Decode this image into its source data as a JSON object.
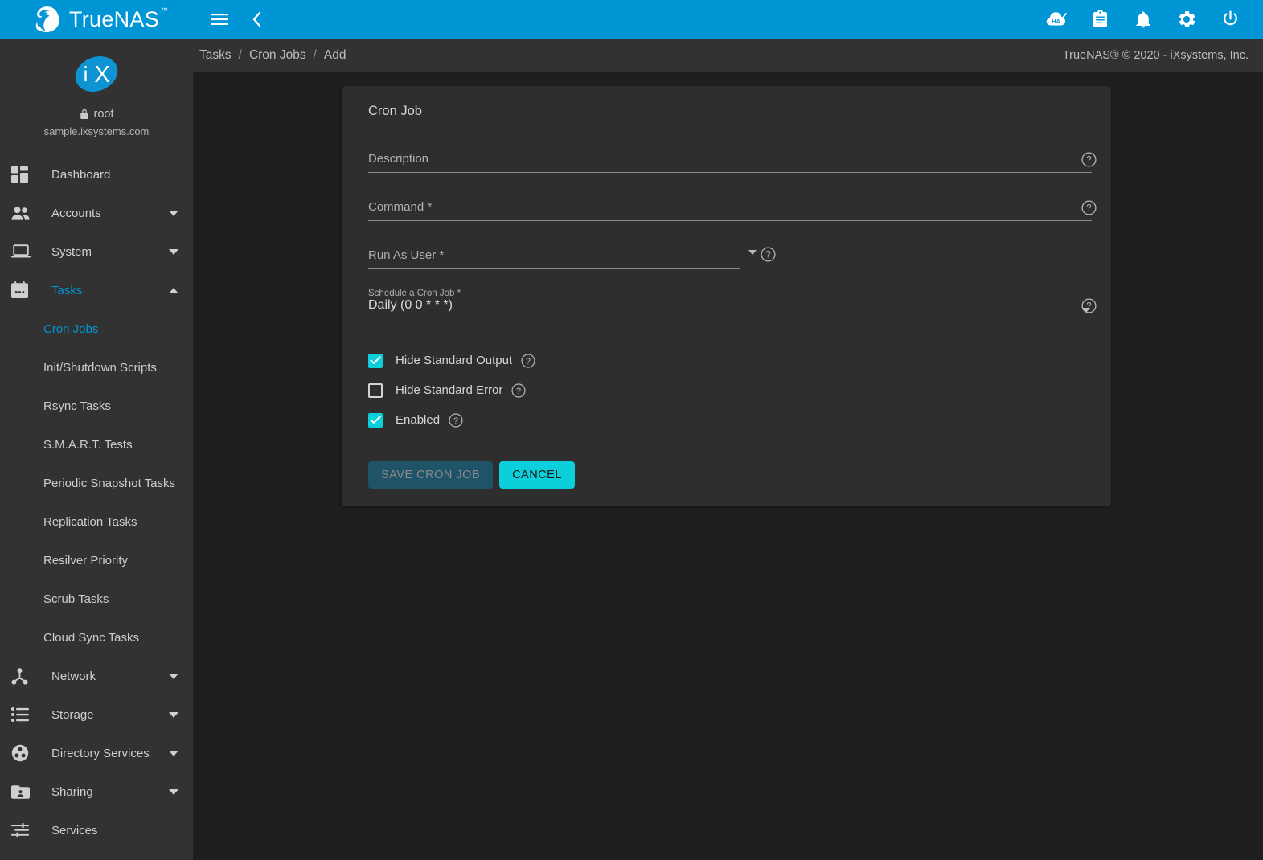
{
  "brand": {
    "name": "TrueNAS",
    "trademark": "™",
    "logo_icon": "truenas-logo-icon"
  },
  "topbar": {
    "menu_toggle_icon": "hamburger-menu-icon",
    "collapse_icon": "chevron-left-icon",
    "right_icons": [
      {
        "name": "ha-status-icon",
        "title": "HA"
      },
      {
        "name": "task-manager-icon",
        "title": ""
      },
      {
        "name": "notifications-bell-icon",
        "title": ""
      },
      {
        "name": "settings-gear-icon",
        "title": ""
      },
      {
        "name": "power-icon",
        "title": ""
      }
    ]
  },
  "sidebar": {
    "profile": {
      "lock_icon": "lock-icon",
      "username": "root",
      "hostname": "sample.ixsystems.com",
      "logo_icon": "ix-logo-icon"
    },
    "items": [
      {
        "label": "Dashboard",
        "icon": "dashboard-icon",
        "expandable": false,
        "active": false
      },
      {
        "label": "Accounts",
        "icon": "accounts-people-icon",
        "expandable": true,
        "expanded": false,
        "active": false
      },
      {
        "label": "System",
        "icon": "system-laptop-icon",
        "expandable": true,
        "expanded": false,
        "active": false
      },
      {
        "label": "Tasks",
        "icon": "tasks-calendar-icon",
        "expandable": true,
        "expanded": true,
        "active": true
      },
      {
        "label": "Network",
        "icon": "network-icon",
        "expandable": true,
        "expanded": false,
        "active": false
      },
      {
        "label": "Storage",
        "icon": "storage-icon",
        "expandable": true,
        "expanded": false,
        "active": false
      },
      {
        "label": "Directory Services",
        "icon": "directory-services-icon",
        "expandable": true,
        "expanded": false,
        "active": false
      },
      {
        "label": "Sharing",
        "icon": "sharing-folder-icon",
        "expandable": true,
        "expanded": false,
        "active": false
      },
      {
        "label": "Services",
        "icon": "services-sliders-icon",
        "expandable": false,
        "active": false
      }
    ],
    "tasks_subitems": [
      {
        "label": "Cron Jobs",
        "active": true
      },
      {
        "label": "Init/Shutdown Scripts",
        "active": false
      },
      {
        "label": "Rsync Tasks",
        "active": false
      },
      {
        "label": "S.M.A.R.T. Tests",
        "active": false
      },
      {
        "label": "Periodic Snapshot Tasks",
        "active": false
      },
      {
        "label": "Replication Tasks",
        "active": false
      },
      {
        "label": "Resilver Priority",
        "active": false
      },
      {
        "label": "Scrub Tasks",
        "active": false
      },
      {
        "label": "Cloud Sync Tasks",
        "active": false
      }
    ]
  },
  "breadcrumb": {
    "items": [
      "Tasks",
      "Cron Jobs",
      "Add"
    ],
    "separator": "/",
    "copyright": "TrueNAS® © 2020 - iXsystems, Inc."
  },
  "form": {
    "card_title": "Cron Job",
    "help_icon": "help-circle-icon",
    "dropdown_icon": "dropdown-arrow-icon",
    "fields": [
      {
        "label": "Description",
        "value": "",
        "placeholder": "",
        "type": "text"
      },
      {
        "label": "Command *",
        "value": "",
        "placeholder": "",
        "type": "text"
      },
      {
        "label": "Run As User *",
        "value": "",
        "placeholder": "",
        "type": "autocomplete"
      },
      {
        "label": "Schedule a Cron Job *",
        "value": "Daily (0 0 * * *)",
        "placeholder": "",
        "type": "select"
      }
    ],
    "checkboxes": [
      {
        "label": "Hide Standard Output",
        "checked": true
      },
      {
        "label": "Hide Standard Error",
        "checked": false
      },
      {
        "label": "Enabled",
        "checked": true
      }
    ],
    "buttons": {
      "save_label": "SAVE CRON JOB",
      "save_disabled": true,
      "cancel_label": "CANCEL"
    }
  },
  "colors": {
    "brand_blue": "#0095d5",
    "accent_cyan": "#0ccfdc",
    "sidebar_bg": "#323232",
    "card_bg": "#2e2e2e",
    "page_bg": "#1e1e1e",
    "save_disabled_bg": "#1f5468"
  }
}
